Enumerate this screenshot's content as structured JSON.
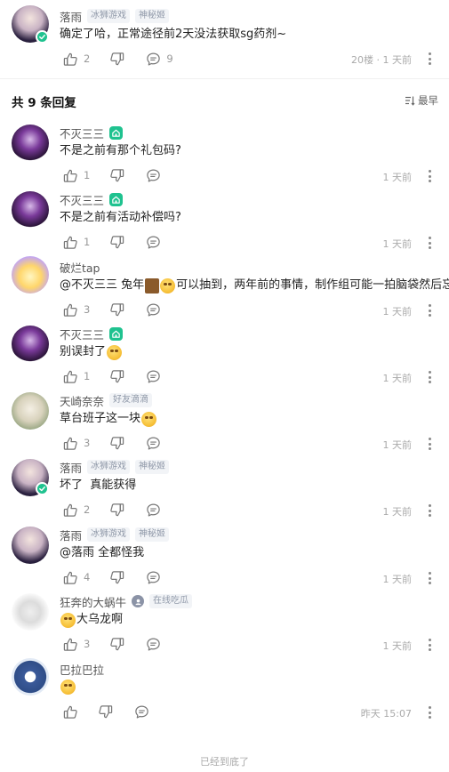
{
  "top_comment": {
    "username": "落雨",
    "tags": [
      "冰狮游戏",
      "神秘姬"
    ],
    "text": "确定了哈，正常途径前2天没法获取sg药剂~",
    "likes": "2",
    "replies_count": "9",
    "meta": "20楼 · 1 天前"
  },
  "reply_section": {
    "header": "共 9 条回复",
    "sort_label": "最早"
  },
  "replies": [
    {
      "username": "不灭三三",
      "text": "不是之前有那个礼包码?",
      "likes": "1",
      "time": "1 天前"
    },
    {
      "username": "不灭三三",
      "text": "不是之前有活动补偿吗?",
      "likes": "1",
      "time": "1 天前"
    },
    {
      "username": "破烂tap",
      "text_before": "@不灭三三 兔年",
      "text_after": "可以抽到，两年前的事情，制作组可能一拍脑袋然后忘了",
      "likes": "3",
      "time": "1 天前"
    },
    {
      "username": "不灭三三",
      "text": "别误封了",
      "likes": "1",
      "time": "1 天前"
    },
    {
      "username": "天崎奈奈",
      "tag": "好友滴滴",
      "text": "草台班子这一块",
      "likes": "3",
      "time": "1 天前"
    },
    {
      "username": "落雨",
      "tags": [
        "冰狮游戏",
        "神秘姬"
      ],
      "text": "坏了  真能获得",
      "likes": "2",
      "time": "1 天前"
    },
    {
      "username": "落雨",
      "tags": [
        "冰狮游戏",
        "神秘姬"
      ],
      "text": "@落雨 全都怪我",
      "likes": "4",
      "time": "1 天前"
    },
    {
      "username": "狂奔的大蜗牛",
      "tag": "在线吃瓜",
      "text": "大乌龙啊",
      "likes": "3",
      "time": "1 天前"
    },
    {
      "username": "巴拉巴拉",
      "text": "",
      "likes": "",
      "time": "昨天 15:07"
    }
  ],
  "footer": "已经到底了",
  "colors": {
    "accent_green": "#1fc28f",
    "meta_gray": "#999999"
  }
}
